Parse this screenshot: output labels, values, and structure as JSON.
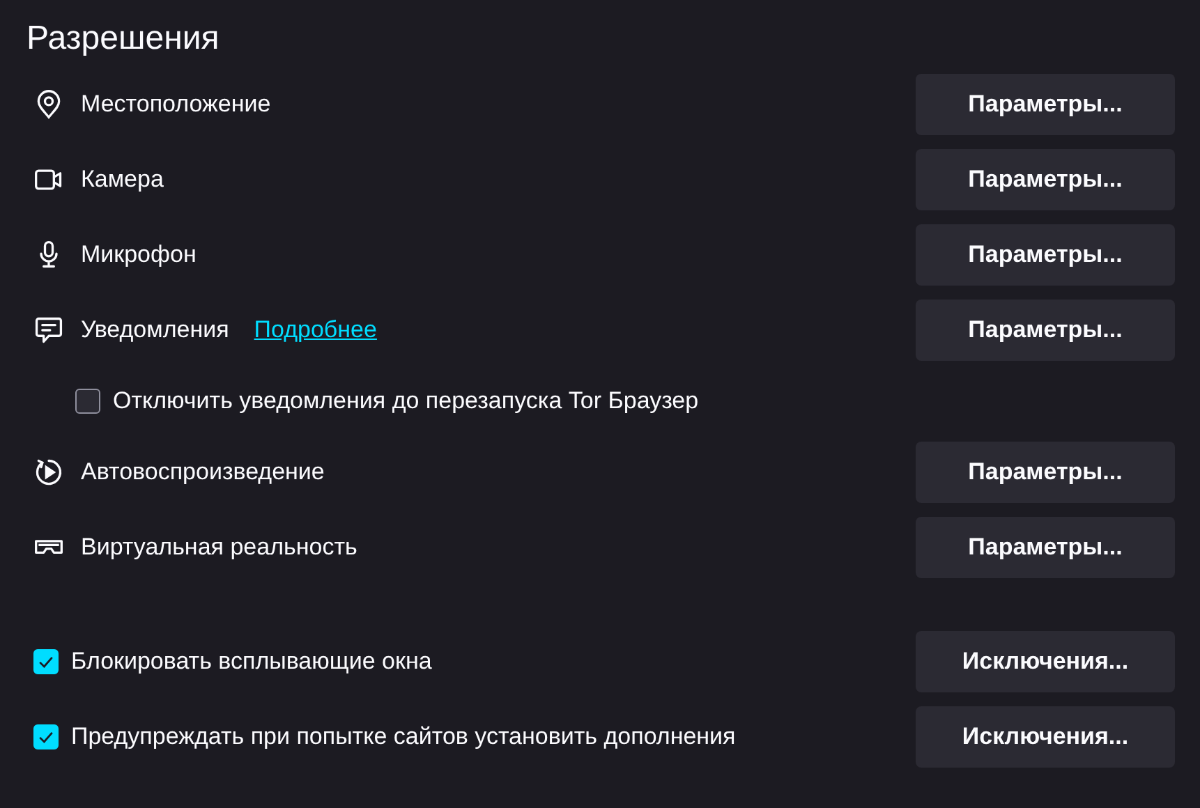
{
  "title": "Разрешения",
  "permissions": [
    {
      "kind": "location",
      "label": "Местоположение",
      "button": "Параметры..."
    },
    {
      "kind": "camera",
      "label": "Камера",
      "button": "Параметры..."
    },
    {
      "kind": "microphone",
      "label": "Микрофон",
      "button": "Параметры..."
    },
    {
      "kind": "notifications",
      "label": "Уведомления",
      "link": "Подробнее",
      "button": "Параметры...",
      "option": {
        "label": "Отключить уведомления до перезапуска Tor Браузер",
        "checked": false
      }
    },
    {
      "kind": "autoplay",
      "label": "Автовоспроизведение",
      "button": "Параметры..."
    },
    {
      "kind": "vr",
      "label": "Виртуальная реальность",
      "button": "Параметры..."
    }
  ],
  "toggles": [
    {
      "label": "Блокировать всплывающие окна",
      "checked": true,
      "button": "Исключения..."
    },
    {
      "label": "Предупреждать при попытке сайтов установить дополнения",
      "checked": true,
      "button": "Исключения..."
    }
  ]
}
